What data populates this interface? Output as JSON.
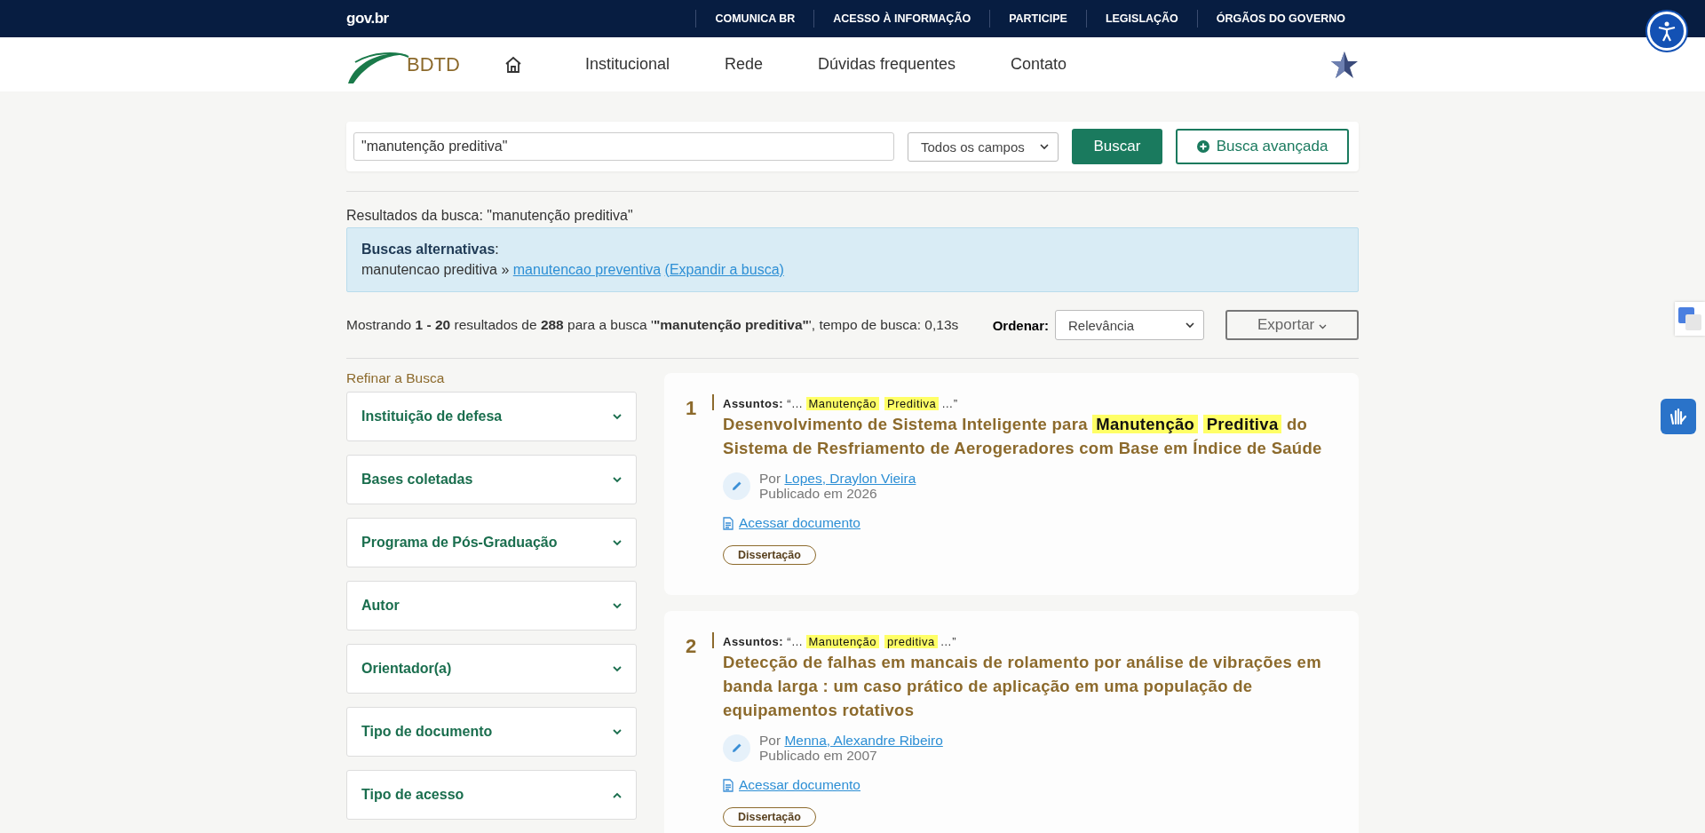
{
  "gov_bar": {
    "logo": "gov.br",
    "links": [
      "COMUNICA BR",
      "ACESSO À INFORMAÇÃO",
      "PARTICIPE",
      "LEGISLAÇÃO",
      "ÓRGÃOS DO GOVERNO"
    ]
  },
  "header": {
    "logo": "BDTD",
    "nav": [
      "Institucional",
      "Rede",
      "Dúvidas frequentes",
      "Contato"
    ]
  },
  "search": {
    "value": "\"manutenção preditiva\"",
    "field": "Todos os campos",
    "submit": "Buscar",
    "advanced": "Busca avançada"
  },
  "results_title": "Resultados da busca: \"manutenção preditiva\"",
  "alternatives": {
    "heading": "**Buscas alternativas**:",
    "original": "manutencao preditiva »",
    "suggestion": "manutencao preventiva",
    "expand": "(Expandir a busca)"
  },
  "summary": "Mostrando **1 - 20** resultados de **288** para a busca '**\"manutenção preditiva\"**', tempo de busca: 0,13s",
  "sort": {
    "label": "Ordenar:",
    "value": "Relevância"
  },
  "export": "Exportar",
  "refine_title": "Refinar a Busca",
  "facets": [
    {
      "label": "Instituição de defesa",
      "expanded": false
    },
    {
      "label": "Bases coletadas",
      "expanded": false
    },
    {
      "label": "Programa de Pós-Graduação",
      "expanded": false
    },
    {
      "label": "Autor",
      "expanded": false
    },
    {
      "label": "Orientador(a)",
      "expanded": false
    },
    {
      "label": "Tipo de documento",
      "expanded": false
    },
    {
      "label": "Tipo de acesso",
      "expanded": true
    }
  ],
  "results": [
    {
      "number": "1",
      "subjects_label": "Assuntos:",
      "subjects": [
        {
          "text": "“…",
          "highlight": false
        },
        {
          "text": "Manutenção",
          "highlight": true
        },
        {
          "text": "Preditiva",
          "highlight": true
        },
        {
          "text": "…”",
          "highlight": false
        }
      ],
      "title": [
        {
          "text": "Desenvolvimento de Sistema Inteligente para",
          "highlight": false
        },
        {
          "text": "Manutenção",
          "highlight": true
        },
        {
          "text": "Preditiva",
          "highlight": true
        },
        {
          "text": "do Sistema de Resfriamento de Aerogeradores com Base em Índice de Saúde",
          "highlight": false
        }
      ],
      "by": "Por",
      "author": "Lopes, Draylon Vieira",
      "published": "Publicado em 2026",
      "access": "Acessar documento",
      "type": "Dissertação"
    },
    {
      "number": "2",
      "subjects_label": "Assuntos:",
      "subjects": [
        {
          "text": "“…",
          "highlight": false
        },
        {
          "text": "Manutenção",
          "highlight": true
        },
        {
          "text": "preditiva",
          "highlight": true
        },
        {
          "text": "…”",
          "highlight": false
        }
      ],
      "title": [
        {
          "text": "Detecção de falhas em mancais de rolamento por análise de vibrações em banda larga : um caso prático de aplicação em uma população de equipamentos rotativos",
          "highlight": false
        }
      ],
      "by": "Por",
      "author": "Menna, Alexandre Ribeiro",
      "published": "Publicado em 2007",
      "access": "Acessar documento",
      "type": "Dissertação"
    }
  ]
}
